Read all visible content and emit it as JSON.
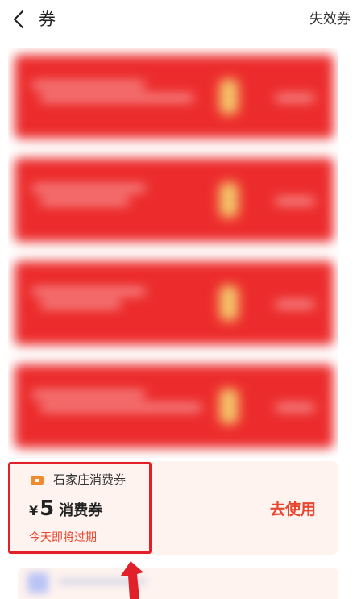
{
  "header": {
    "title": "券",
    "invalid_link": "失效券",
    "back_icon": "chevron-left-icon"
  },
  "coupon": {
    "name": "石家庄消费券",
    "currency": "¥",
    "amount": "5",
    "amount_label": "消费券",
    "expire_text": "今天即将过期",
    "use_button": "去使用",
    "icon": "ticket-icon"
  },
  "colors": {
    "accent": "#e8452f",
    "highlight": "#e1202a",
    "card_bg": "#fff3ef"
  }
}
